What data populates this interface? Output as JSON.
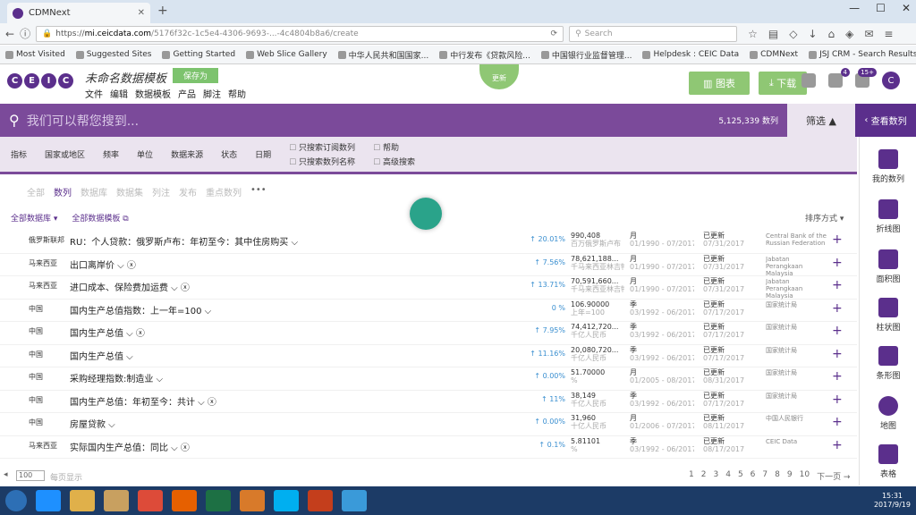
{
  "browser": {
    "tab_title": "CDMNext",
    "new_tab": "+",
    "url_prefix": "https://",
    "url_domain": "mi.ceicdata.com",
    "url_rest": "/5176f32c-1c5e4-4306-9693-...-4c4804b8a6/create",
    "search_placeholder": "Search",
    "bookmarks": [
      "Most Visited",
      "Suggested Sites",
      "Getting Started",
      "Web Slice Gallery",
      "中华人民共和国国家...",
      "中行发布《贷款风险...",
      "中国银行业监督管理...",
      "Helpdesk : CEIC Data",
      "CDMNext",
      "JSJ CRM - Search Results"
    ]
  },
  "app": {
    "logo_letters": [
      "C",
      "E",
      "I",
      "C"
    ],
    "doc_title": "未命名数据模板",
    "draft_badge": "保存为",
    "menu": [
      "文件",
      "编辑",
      "数据模板",
      "产品",
      "脚注",
      "帮助"
    ],
    "bubble_label": "更新",
    "btn_primary": "图表",
    "btn_download": "下载",
    "notif_count": "4",
    "alert_count": "15+",
    "avatar_letter": "C"
  },
  "search": {
    "placeholder": "我们可以帮您搜到...",
    "result_count": "5,125,339 数列",
    "filter_label": "筛选 ▲",
    "series_button": "查看数列"
  },
  "filters": {
    "dropdowns": [
      "指标",
      "国家或地区",
      "频率",
      "单位",
      "数据来源",
      "状态",
      "日期"
    ],
    "checks_a": [
      "只搜索订阅数列",
      "只搜索数列名称"
    ],
    "checks_b": [
      "帮助",
      "高级搜索"
    ]
  },
  "result_tabs": [
    "全部",
    "数列",
    "数据库",
    "数据集",
    "列注",
    "发布",
    "重点数列"
  ],
  "result_tab_more": "•••",
  "db_links": [
    "全部数据库 ▾",
    "全部数据模板 ⧉"
  ],
  "sort_label": "排序方式 ▾",
  "right_panel": [
    "我的数列",
    "折线图",
    "面积图",
    "柱状图",
    "条形图",
    "地图",
    "表格"
  ],
  "rows": [
    {
      "region": "俄罗斯联邦",
      "name": "RU：个人贷款：俄罗斯卢布：年初至今：其中住房购买 ⌵",
      "change": "↑ 20.01%",
      "val": "990,408",
      "val2": "百万俄罗斯卢布",
      "freq": "月",
      "freq2": "01/1990 - 07/2017",
      "status": "已更新",
      "status2": "07/31/2017",
      "src": "Central Bank of the Russian Federation"
    },
    {
      "region": "马来西亚",
      "name": "出口离岸价 ⌵ ⓧ",
      "change": "↑ 7.56%",
      "val": "78,621,188...",
      "val2": "千马来西亚林吉特",
      "freq": "月",
      "freq2": "01/1990 - 07/2017",
      "status": "已更新",
      "status2": "07/31/2017",
      "src": "Jabatan Perangkaan Malaysia"
    },
    {
      "region": "马来西亚",
      "name": "进口成本、保险费加运费 ⌵ ⓧ",
      "change": "↑ 13.71%",
      "val": "70,591,660...",
      "val2": "千马来西亚林吉特",
      "freq": "月",
      "freq2": "01/1990 - 07/2017",
      "status": "已更新",
      "status2": "07/31/2017",
      "src": "Jabatan Perangkaan Malaysia"
    },
    {
      "region": "中国",
      "name": "国内生产总值指数：上一年=100 ⌵",
      "change": "0 %",
      "val": "106.90000",
      "val2": "上年=100",
      "freq": "季",
      "freq2": "03/1992 - 06/2017",
      "status": "已更新",
      "status2": "07/17/2017",
      "src": "国家统计局"
    },
    {
      "region": "中国",
      "name": "国内生产总值 ⌵ ⓧ",
      "change": "↑ 7.95%",
      "val": "74,412,720...",
      "val2": "千亿人民币",
      "freq": "季",
      "freq2": "03/1992 - 06/2017",
      "status": "已更新",
      "status2": "07/17/2017",
      "src": "国家统计局"
    },
    {
      "region": "中国",
      "name": "国内生产总值 ⌵",
      "change": "↑ 11.16%",
      "val": "20,080,720...",
      "val2": "千亿人民币",
      "freq": "季",
      "freq2": "03/1992 - 06/2017",
      "status": "已更新",
      "status2": "07/17/2017",
      "src": "国家统计局"
    },
    {
      "region": "中国",
      "name": "采购经理指数:制造业 ⌵",
      "change": "↑ 0.00%",
      "val": "51.70000",
      "val2": "%",
      "freq": "月",
      "freq2": "01/2005 - 08/2017",
      "status": "已更新",
      "status2": "08/31/2017",
      "src": "国家统计局"
    },
    {
      "region": "中国",
      "name": "国内生产总值：年初至今：共计 ⌵ ⓧ",
      "change": "↑ 11%",
      "val": "38,149",
      "val2": "千亿人民币",
      "freq": "季",
      "freq2": "03/1992 - 06/2017",
      "status": "已更新",
      "status2": "07/17/2017",
      "src": "国家统计局"
    },
    {
      "region": "中国",
      "name": "房屋贷款 ⌵",
      "change": "↑ 0.00%",
      "val": "31,960",
      "val2": "十亿人民币",
      "freq": "月",
      "freq2": "01/2006 - 07/2017",
      "status": "已更新",
      "status2": "08/11/2017",
      "src": "中国人民银行"
    },
    {
      "region": "马来西亚",
      "name": "实际国内生产总值：同比 ⌵ ⓧ",
      "change": "↑ 0.1%",
      "val": "5.81101",
      "val2": "%",
      "freq": "季",
      "freq2": "03/1992 - 06/2017",
      "status": "已更新",
      "status2": "08/17/2017",
      "src": "CEIC Data"
    }
  ],
  "pagination": {
    "per_page": "100",
    "per_page_label": "每页显示",
    "pages": [
      "1",
      "2",
      "3",
      "4",
      "5",
      "6",
      "7",
      "8",
      "9",
      "10",
      "下一页 →"
    ]
  },
  "taskbar": {
    "time": "15:31",
    "date": "2017/9/19"
  },
  "colors": {
    "brand": "#5b2f8c",
    "search_bar": "#7b4a9a",
    "accent_green": "#8fc774",
    "spinner": "#2aa38a"
  }
}
